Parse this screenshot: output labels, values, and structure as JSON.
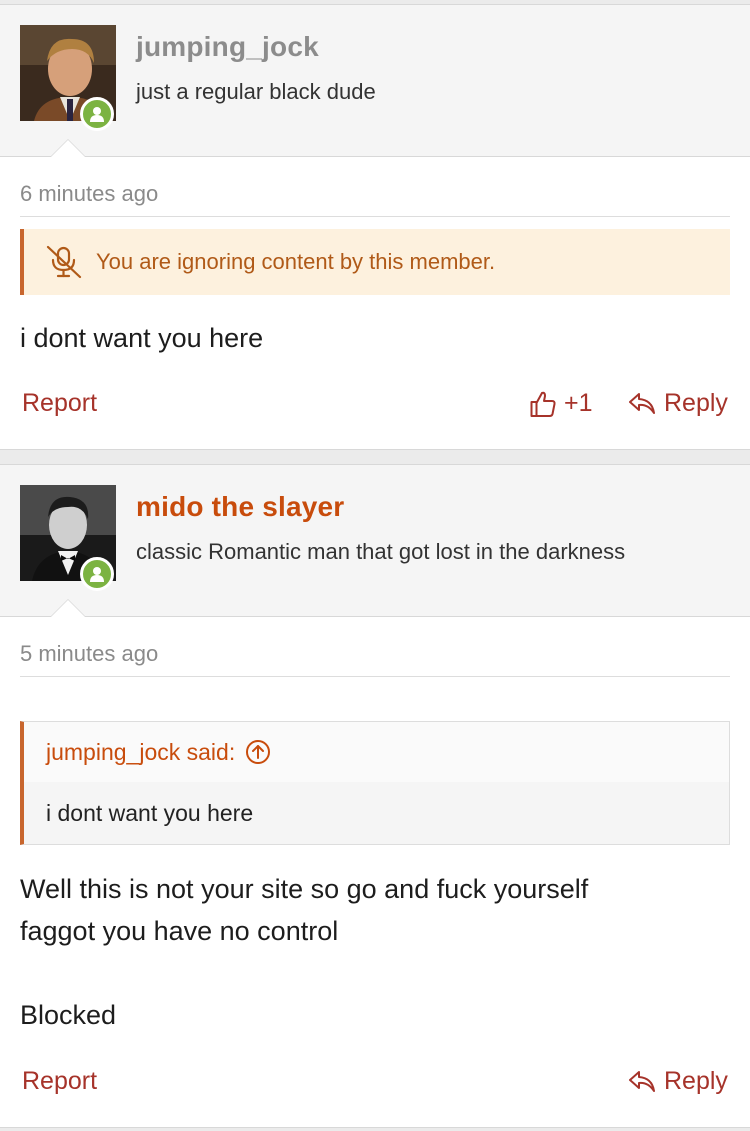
{
  "posts": [
    {
      "username": "jumping_jock",
      "user_title": "just a regular black dude",
      "timestamp": "6 minutes ago",
      "ignore_notice": "You are ignoring content by this member.",
      "body": "i dont want you here",
      "report_label": "Report",
      "like_count": "+1",
      "reply_label": "Reply"
    },
    {
      "username": "mido the slayer",
      "user_title": "classic Romantic man that got lost in the darkness",
      "timestamp": "5 minutes ago",
      "quote": {
        "author_label": "jumping_jock said:",
        "text": "i dont want you here"
      },
      "body_line1": "Well this is not your site so go and fuck yourself",
      "body_line2": "faggot you have no control",
      "body_line3": "Blocked",
      "report_label": "Report",
      "reply_label": "Reply"
    }
  ],
  "colors": {
    "accent": "#a6332a",
    "username_highlight": "#c84c0c",
    "online": "#7cb342",
    "notice_bg": "#fdf1de"
  },
  "icons": {
    "online_badge": "user-online-icon",
    "ignore": "ignore-muted-icon",
    "like": "thumbs-up-icon",
    "reply": "reply-arrow-icon",
    "quote_jump": "arrow-up-circle-icon"
  }
}
